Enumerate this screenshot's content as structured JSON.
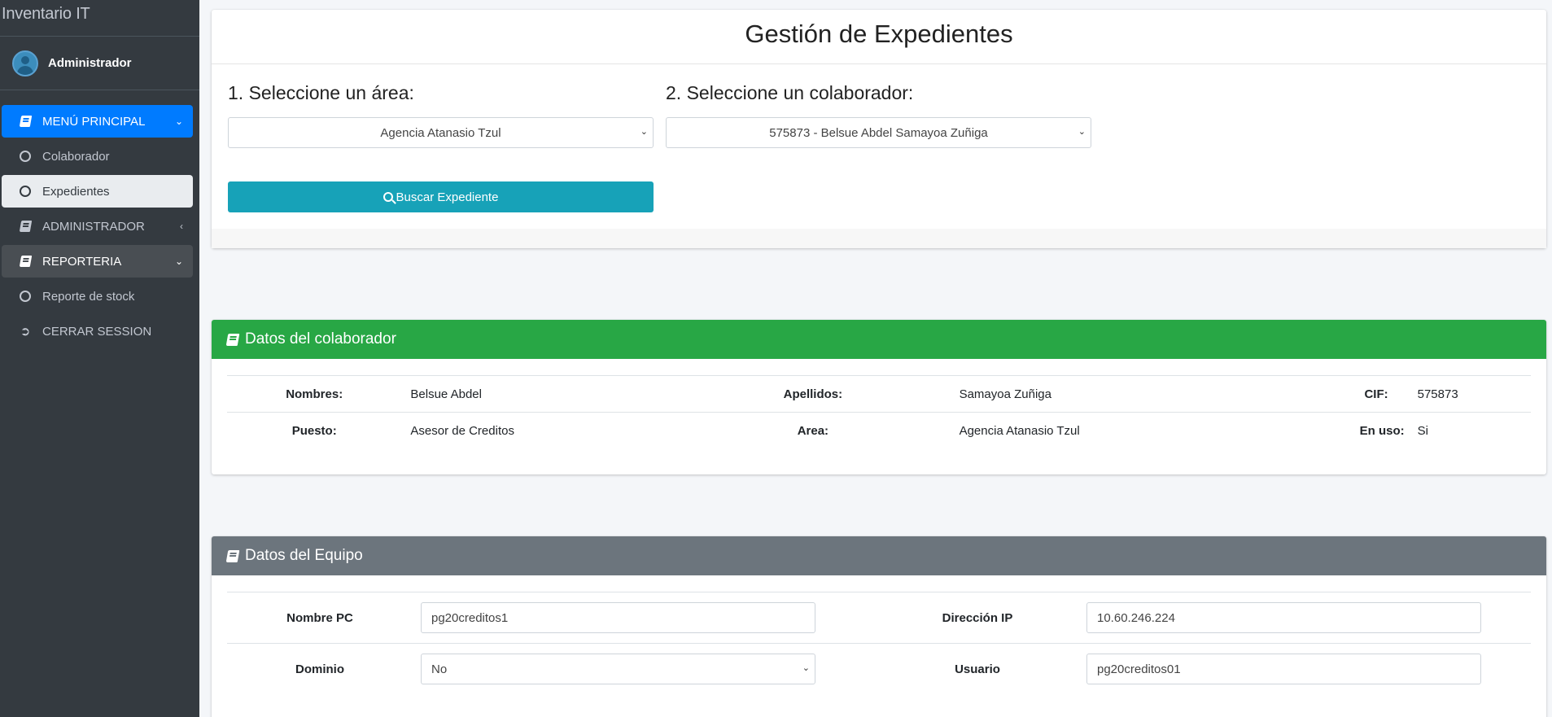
{
  "app": {
    "brand": "Inventario IT",
    "user": "Administrador"
  },
  "sidebar": {
    "items": [
      {
        "label": "MENÚ PRINCIPAL",
        "icon": "book-icon",
        "arrow": "⌄"
      },
      {
        "label": "Colaborador",
        "icon": "circle-icon"
      },
      {
        "label": "Expedientes",
        "icon": "circle-icon"
      },
      {
        "label": "ADMINISTRADOR",
        "icon": "book-icon",
        "arrow": "‹"
      },
      {
        "label": "REPORTERIA",
        "icon": "book-icon",
        "arrow": "⌄"
      },
      {
        "label": "Reporte de stock",
        "icon": "circle-icon"
      },
      {
        "label": "CERRAR SESSION",
        "icon": "logout-icon"
      }
    ]
  },
  "search": {
    "title": "Gestión de Expedientes",
    "area_label": "1. Seleccione un área:",
    "area_value": "Agencia Atanasio Tzul",
    "colab_label": "2. Seleccione un colaborador:",
    "colab_value": "575873 - Belsue Abdel Samayoa Zuñiga",
    "button_label": "Buscar Expediente"
  },
  "colaborador": {
    "header": "Datos del colaborador",
    "nombres_label": "Nombres:",
    "nombres": "Belsue Abdel",
    "apellidos_label": "Apellidos:",
    "apellidos": "Samayoa Zuñiga",
    "cif_label": "CIF:",
    "cif": "575873",
    "puesto_label": "Puesto:",
    "puesto": "Asesor de Creditos",
    "area_label": "Area:",
    "area": "Agencia Atanasio Tzul",
    "en_uso_label": "En uso:",
    "en_uso": "Si"
  },
  "equipo": {
    "header": "Datos del Equipo",
    "nombre_pc_label": "Nombre PC",
    "nombre_pc": "pg20creditos1",
    "ip_label": "Dirección IP",
    "ip": "10.60.246.224",
    "dominio_label": "Dominio",
    "dominio": "No",
    "usuario_label": "Usuario",
    "usuario": "pg20creditos01"
  },
  "colors": {
    "primary": "#007bff",
    "info": "#17a2b8",
    "success": "#28a745",
    "secondary": "#6c757d",
    "sidebar": "#343a40"
  }
}
